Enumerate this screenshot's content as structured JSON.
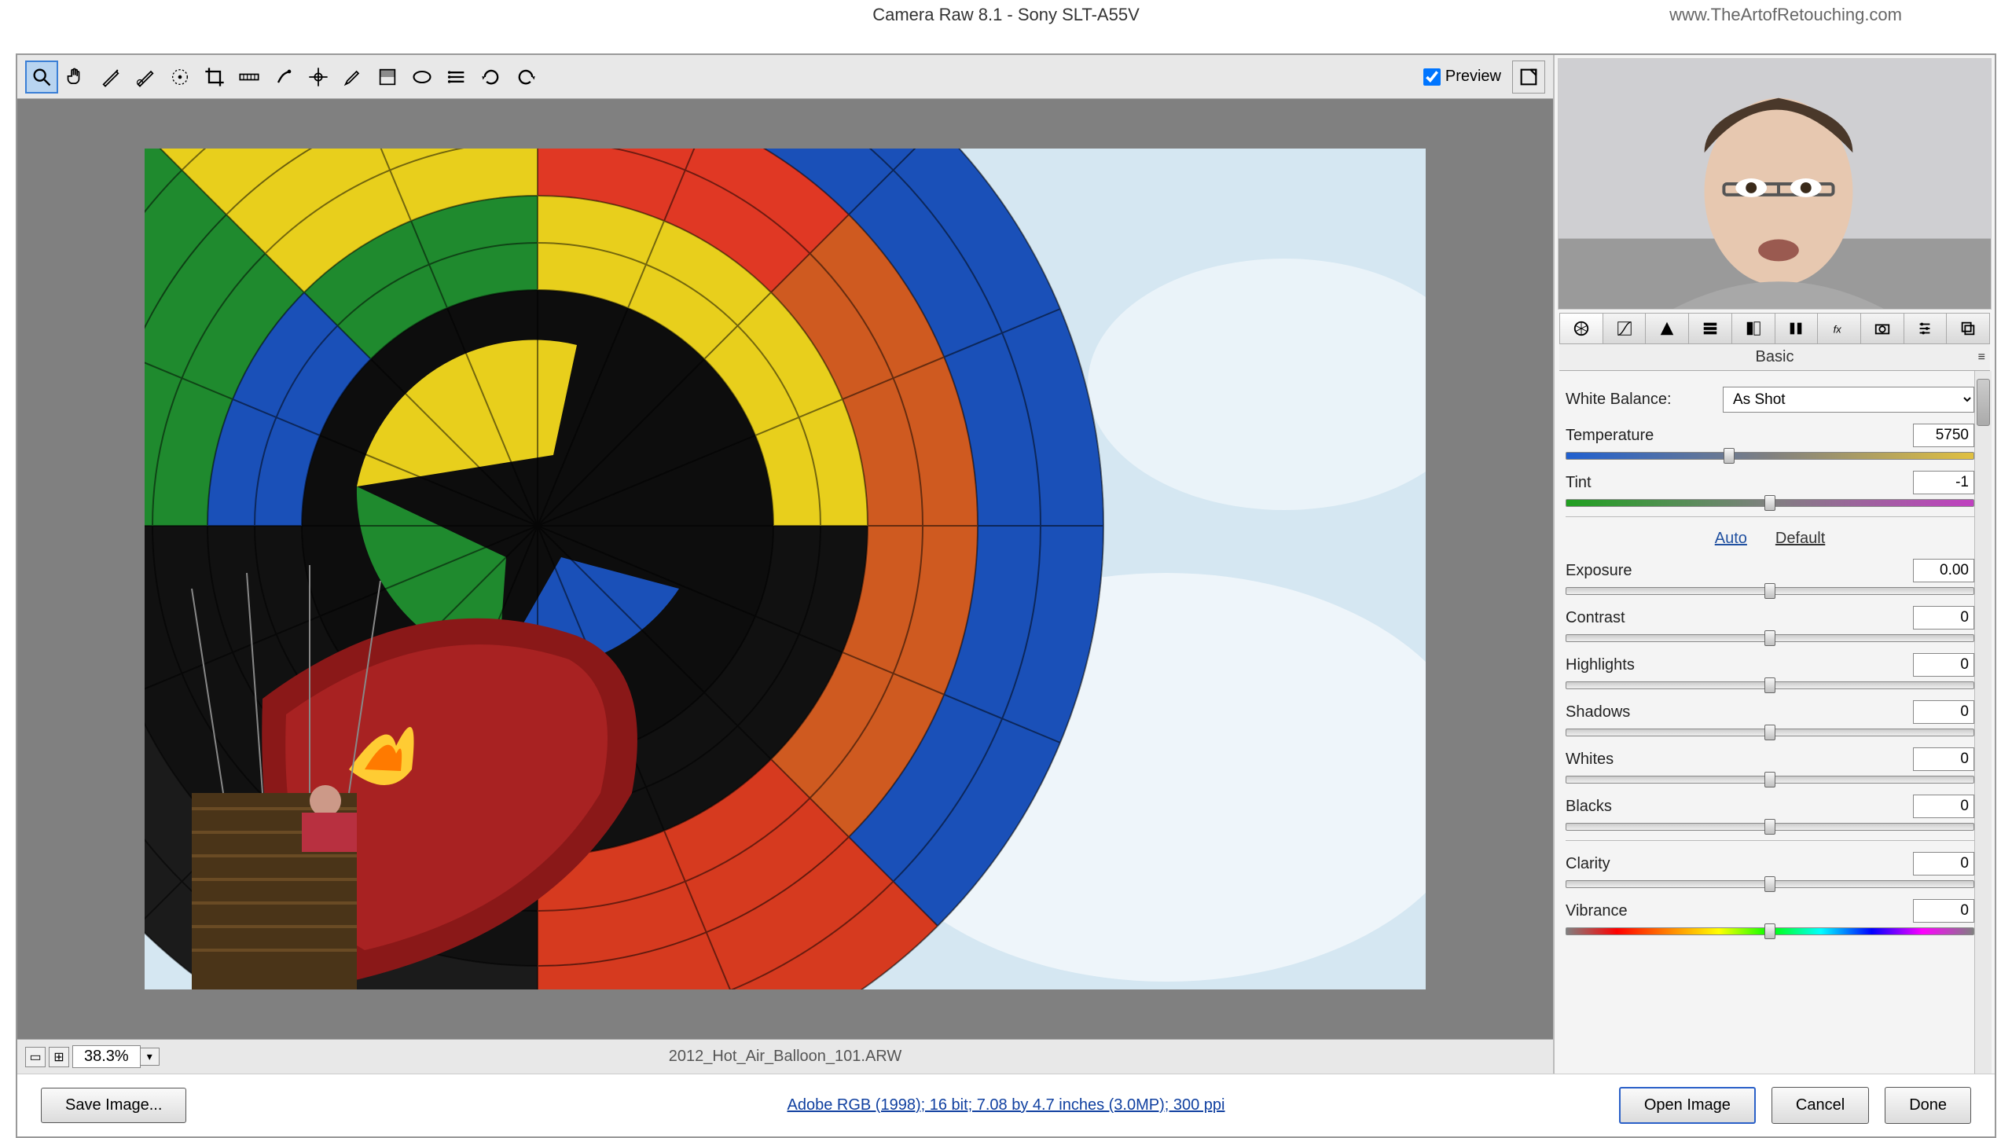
{
  "title": "Camera Raw 8.1  -  Sony SLT-A55V",
  "watermark": "www.TheArtofRetouching.com",
  "toolbar": {
    "preview_label": "Preview",
    "preview_checked": true
  },
  "preview": {
    "zoom_level": "38.3%",
    "filename": "2012_Hot_Air_Balloon_101.ARW"
  },
  "panel": {
    "active_tab": "basic",
    "header": "Basic",
    "wb_label": "White Balance:",
    "wb_value": "As Shot",
    "auto_label": "Auto",
    "default_label": "Default",
    "sliders": {
      "temperature": {
        "label": "Temperature",
        "value": "5750",
        "pos": 40,
        "track": "track-temp"
      },
      "tint": {
        "label": "Tint",
        "value": "-1",
        "pos": 50,
        "track": "track-tint"
      },
      "exposure": {
        "label": "Exposure",
        "value": "0.00",
        "pos": 50,
        "track": "track-gray"
      },
      "contrast": {
        "label": "Contrast",
        "value": "0",
        "pos": 50,
        "track": "track-gray"
      },
      "highlights": {
        "label": "Highlights",
        "value": "0",
        "pos": 50,
        "track": "track-gray"
      },
      "shadows": {
        "label": "Shadows",
        "value": "0",
        "pos": 50,
        "track": "track-gray"
      },
      "whites": {
        "label": "Whites",
        "value": "0",
        "pos": 50,
        "track": "track-gray"
      },
      "blacks": {
        "label": "Blacks",
        "value": "0",
        "pos": 50,
        "track": "track-gray"
      },
      "clarity": {
        "label": "Clarity",
        "value": "0",
        "pos": 50,
        "track": "track-gray"
      },
      "vibrance": {
        "label": "Vibrance",
        "value": "0",
        "pos": 50,
        "track": "track-rainbow"
      }
    }
  },
  "footer": {
    "save_image": "Save Image...",
    "workflow_link": "Adobe RGB (1998); 16 bit; 7.08 by 4.7 inches (3.0MP); 300 ppi",
    "open_image": "Open Image",
    "cancel": "Cancel",
    "done": "Done"
  }
}
